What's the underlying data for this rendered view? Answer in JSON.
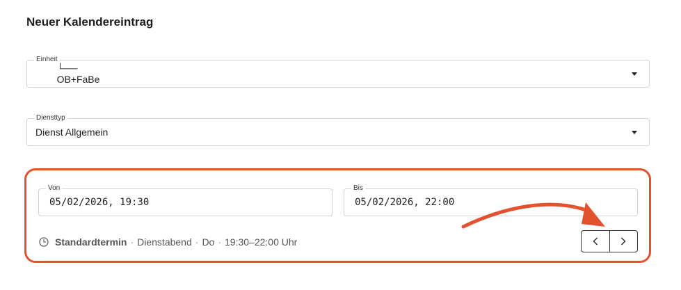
{
  "page": {
    "title": "Neuer Kalendereintrag"
  },
  "fields": {
    "einheit": {
      "label": "Einheit",
      "tree_prefix": "└──",
      "value": "OB+FaBe"
    },
    "diensttyp": {
      "label": "Diensttyp",
      "value": "Dienst Allgemein"
    },
    "von": {
      "label": "Von",
      "value": "05/02/2026, 19:30"
    },
    "bis": {
      "label": "Bis",
      "value": "05/02/2026, 22:00"
    }
  },
  "status": {
    "icon": "clock-icon",
    "name": "Standardtermin",
    "separator": "·",
    "parts": [
      "Dienstabend",
      "Do",
      "19:30–22:00 Uhr"
    ]
  },
  "nav": {
    "prev_icon": "chevron-left-icon",
    "next_icon": "chevron-right-icon"
  },
  "annotation": {
    "accent_color": "#e2522e"
  }
}
